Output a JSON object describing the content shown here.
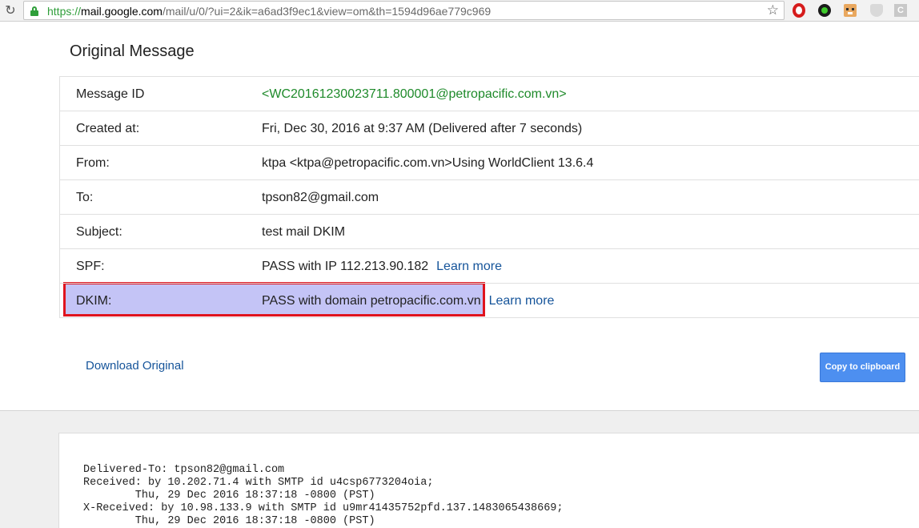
{
  "browser": {
    "url_scheme": "https://",
    "url_host": "mail.google.com",
    "url_path": "/mail/u/0/?ui=2&ik=a6ad3f9ec1&view=om&th=1594d96ae779c969",
    "extensions": [
      "opera-icon",
      "green-dot-icon",
      "face-icon",
      "shield-icon",
      "c-icon"
    ],
    "ext_c_label": "C"
  },
  "panel": {
    "title": "Original Message",
    "rows": [
      {
        "key": "Message ID",
        "value": "<WC20161230023711.800001@petropacific.com.vn>"
      },
      {
        "key": "Created at:",
        "value": "Fri, Dec 30, 2016 at 9:37 AM (Delivered after 7 seconds)"
      },
      {
        "key": "From:",
        "value": "ktpa <ktpa@petropacific.com.vn>Using WorldClient 13.6.4"
      },
      {
        "key": "To:",
        "value": "tpson82@gmail.com"
      },
      {
        "key": "Subject:",
        "value": "test mail DKIM"
      },
      {
        "key": "SPF:",
        "value": "PASS with IP 112.213.90.182",
        "link": "Learn more"
      },
      {
        "key": "DKIM:",
        "value": "PASS with domain petropacific.com.vn",
        "link": "Learn more"
      }
    ],
    "download_label": "Download Original",
    "copy_label": "Copy to clipboard"
  },
  "raw": {
    "lines": [
      "Delivered-To: tpson82@gmail.com",
      "Received: by 10.202.71.4 with SMTP id u4csp6773204oia;",
      "        Thu, 29 Dec 2016 18:37:18 -0800 (PST)",
      "X-Received: by 10.98.133.9 with SMTP id u9mr41435752pfd.137.1483065438669;",
      "        Thu, 29 Dec 2016 18:37:18 -0800 (PST)"
    ]
  },
  "colors": {
    "link": "#15549a",
    "message_id": "#1e8a2a",
    "highlight_fill": "#c4c4f6",
    "highlight_border": "#e0141e",
    "button": "#4d8ff0"
  }
}
